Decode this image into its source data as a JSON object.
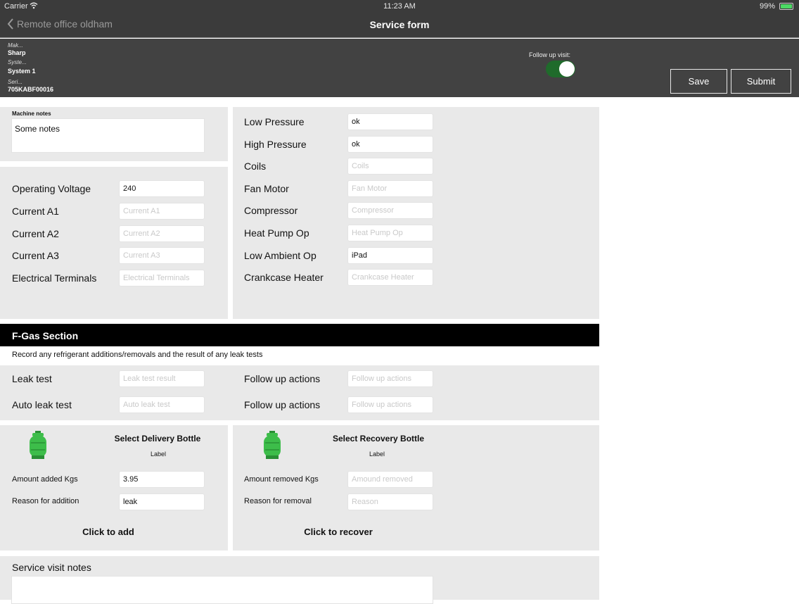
{
  "status_bar": {
    "carrier": "Carrier",
    "time": "11:23 AM",
    "battery": "99%"
  },
  "nav": {
    "back_label": "Remote office oldham",
    "title": "Service form"
  },
  "header": {
    "make_label": "Mak...",
    "make_value": "Sharp",
    "system_label": "Syste...",
    "system_value": "System 1",
    "serial_label": "Seri...",
    "serial_value": "705KABF00016",
    "follow_up_label": "Follow up visit:",
    "follow_up_on": true,
    "save_label": "Save",
    "submit_label": "Submit"
  },
  "machine_notes": {
    "label": "Machine notes",
    "value": "Some notes"
  },
  "electrical": [
    {
      "label": "Operating Voltage",
      "value": "240",
      "placeholder": ""
    },
    {
      "label": "Current A1",
      "value": "",
      "placeholder": "Current A1"
    },
    {
      "label": "Current A2",
      "value": "",
      "placeholder": "Current A2"
    },
    {
      "label": "Current A3",
      "value": "",
      "placeholder": "Current A3"
    },
    {
      "label": "Electrical Terminals",
      "value": "",
      "placeholder": "Electrical Terminals"
    }
  ],
  "mechanical": [
    {
      "label": "Low Pressure",
      "value": "ok",
      "placeholder": ""
    },
    {
      "label": "High Pressure",
      "value": "ok",
      "placeholder": ""
    },
    {
      "label": "Coils",
      "value": "",
      "placeholder": "Coils"
    },
    {
      "label": "Fan Motor",
      "value": "",
      "placeholder": "Fan Motor"
    },
    {
      "label": "Compressor",
      "value": "",
      "placeholder": "Compressor"
    },
    {
      "label": "Heat Pump Op",
      "value": "",
      "placeholder": "Heat Pump Op"
    },
    {
      "label": "Low Ambient Op",
      "value": "iPad",
      "placeholder": ""
    },
    {
      "label": "Crankcase Heater",
      "value": "",
      "placeholder": "Crankcase Heater"
    }
  ],
  "fgas": {
    "title": "F-Gas Section",
    "description": "Record any refrigerant additions/removals and the result of any leak tests",
    "leak_test_label": "Leak test",
    "leak_test_placeholder": "Leak test result",
    "auto_leak_label": "Auto leak test",
    "auto_leak_placeholder": "Auto leak test",
    "follow_up_1_label": "Follow up actions",
    "follow_up_1_placeholder": "Follow up actions",
    "follow_up_2_label": "Follow up actions",
    "follow_up_2_placeholder": "Follow up actions"
  },
  "delivery": {
    "title": "Select Delivery Bottle",
    "sub": "Label",
    "amount_label": "Amount added Kgs",
    "amount_value": "3.95",
    "reason_label": "Reason for addition",
    "reason_value": "leak",
    "action": "Click to add",
    "bottle_color": "#3dbd4a"
  },
  "recovery": {
    "title": "Select Recovery Bottle",
    "sub": "Label",
    "amount_label": "Amount removed Kgs",
    "amount_placeholder": "Amound removed",
    "reason_label": "Reason for removal",
    "reason_placeholder": "Reason",
    "action": "Click to recover",
    "bottle_color": "#3dbd4a"
  },
  "service_notes": {
    "label": "Service visit notes",
    "value": ""
  }
}
